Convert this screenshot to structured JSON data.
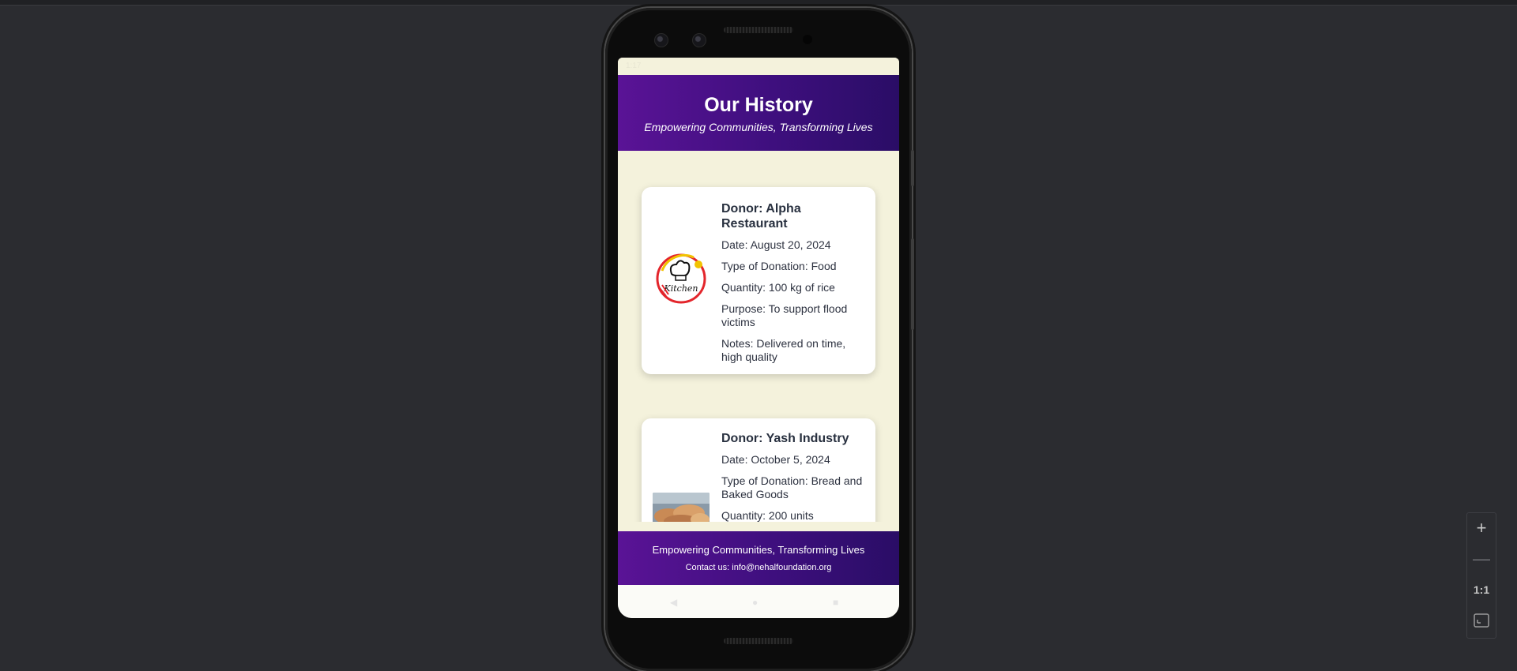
{
  "status_bar": {
    "time": "1:17"
  },
  "header": {
    "title": "Our History",
    "subtitle": "Empowering Communities, Transforming Lives"
  },
  "donations": [
    {
      "donor": "Donor: Alpha Restaurant",
      "date": "Date: August 20, 2024",
      "type": "Type of Donation: Food",
      "quantity": "Quantity: 100 kg of rice",
      "purpose": "Purpose: To support flood victims",
      "notes": "Notes: Delivered on time, high quality",
      "logo_text": "Kitchen"
    },
    {
      "donor": "Donor: Yash Industry",
      "date": "Date: October 5, 2024",
      "type": "Type of Donation: Bread and Baked Goods",
      "quantity": "Quantity: 200 units"
    }
  ],
  "footer": {
    "tagline": "Empowering Communities, Transforming Lives",
    "contact": "Contact us: info@nehalfoundation.org"
  },
  "zoom_controls": {
    "zoom_in": "+",
    "zoom_out": "—",
    "actual_size": "1:1"
  },
  "colors": {
    "header_gradient_start": "#5a1396",
    "header_gradient_end": "#2a0d66",
    "page_background": "#f4f2dc",
    "card_background": "#ffffff"
  }
}
